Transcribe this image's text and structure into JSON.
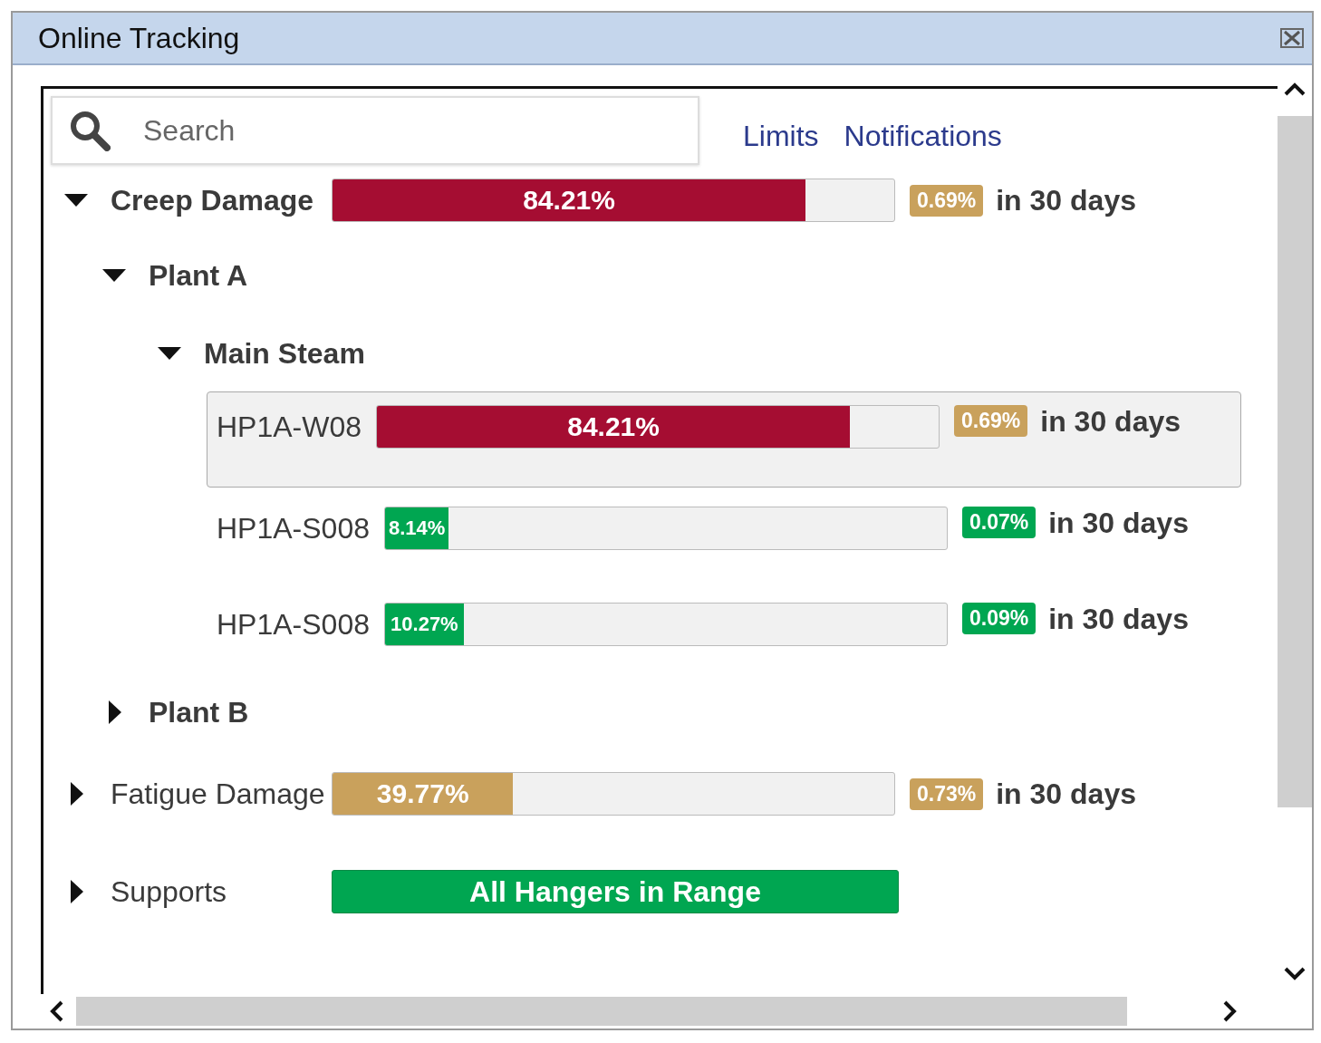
{
  "window": {
    "title": "Online Tracking"
  },
  "search": {
    "placeholder": "Search"
  },
  "links": [
    "Limits",
    "Notifications"
  ],
  "tree": [
    {
      "kind": "meter",
      "label": "Creep Damage",
      "expanded": true,
      "level": 0.8421,
      "reading": "84.21%",
      "color": "#a50d32",
      "change": {
        "text": "0.69%",
        "color": "#c9a15c"
      },
      "period": "in 30 days",
      "children": [
        {
          "label": "Plant A",
          "expanded": true,
          "children": [
            {
              "label": "Main Steam",
              "expanded": true,
              "items": [
                {
                  "label": "HP1A-W08",
                  "selected": true,
                  "level": 0.8421,
                  "reading": "84.21%",
                  "color": "#a50d32",
                  "change": {
                    "text": "0.69%",
                    "color": "#c9a15c"
                  },
                  "period": "in 30 days"
                },
                {
                  "label": "HP1A-S008",
                  "selected": false,
                  "level": 0.1133,
                  "reading": "8.14%",
                  "color": "#00a651",
                  "change": {
                    "text": "0.07%",
                    "color": "#00a651"
                  },
                  "period": "in 30 days"
                },
                {
                  "label": "HP1A-S008",
                  "selected": false,
                  "level": 0.14,
                  "reading": "10.27%",
                  "color": "#00a651",
                  "change": {
                    "text": "0.09%",
                    "color": "#00a651"
                  },
                  "period": "in 30 days"
                }
              ]
            }
          ]
        },
        {
          "label": "Plant B",
          "expanded": false
        }
      ]
    },
    {
      "kind": "meter",
      "label": "Fatigue Damage",
      "expanded": false,
      "level": 0.3216,
      "reading": "39.77%",
      "color": "#c9a15c",
      "change": {
        "text": "0.73%",
        "color": "#c9a15c"
      },
      "period": "in 30 days"
    },
    {
      "kind": "status",
      "label": "Supports",
      "expanded": false,
      "status": "All Hangers in Range",
      "color": "#00a651"
    }
  ]
}
